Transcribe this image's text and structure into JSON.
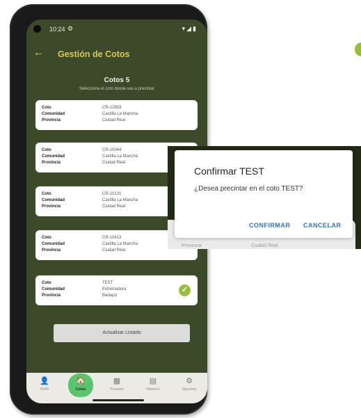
{
  "status_bar": {
    "time": "10:24",
    "gear_glyph": "⚙",
    "icons": "▾◢▮"
  },
  "app_bar": {
    "back_glyph": "←",
    "title": "Gestión de Cotos"
  },
  "section": {
    "title": "Cotos 5",
    "subtitle": "Selecciona el coto donde vas a precintar"
  },
  "labels": {
    "coto": "Coto",
    "comunidad": "Comunidad",
    "provincia": "Provincia"
  },
  "cards": [
    {
      "coto": "CR-12903",
      "comunidad": "Castilla La Mancha",
      "provincia": "Ciudad Real"
    },
    {
      "coto": "CR-10044",
      "comunidad": "Castilla La Mancha",
      "provincia": "Ciudad Real"
    },
    {
      "coto": "CR-10131",
      "comunidad": "Castilla La Mancha",
      "provincia": "Ciudad Real"
    },
    {
      "coto": "CR-10413",
      "comunidad": "Castilla La Mancha",
      "provincia": "Ciudad Real"
    },
    {
      "coto": "TEST",
      "comunidad": "Extremadura",
      "provincia": "Badajoz",
      "selected": true
    }
  ],
  "check_glyph": "✓",
  "refresh_button": "Actualizar Listado",
  "nav": [
    {
      "label": "Perfil",
      "icon": "person-icon",
      "glyph": "👤"
    },
    {
      "label": "Cotos",
      "icon": "home-icon",
      "glyph": "🏠",
      "active": true
    },
    {
      "label": "Precintar",
      "icon": "qr-icon",
      "glyph": "▦"
    },
    {
      "label": "Historico",
      "icon": "history-icon",
      "glyph": "▤"
    },
    {
      "label": "Opciones",
      "icon": "gear-icon",
      "glyph": "⚙"
    }
  ],
  "dialog": {
    "title": "Confirmar TEST",
    "message": "¿Desea precintar en el coto TEST?",
    "confirm": "CONFIRMAR",
    "cancel": "CANCELAR",
    "background_label": "Provincia",
    "background_value": "Ciudad Real"
  },
  "colors": {
    "screen_bg": "#3d4a2a",
    "accent": "#d6c85a",
    "check": "#9bbd3c",
    "nav_active": "#58c46d",
    "dialog_button": "#2f73b8"
  }
}
